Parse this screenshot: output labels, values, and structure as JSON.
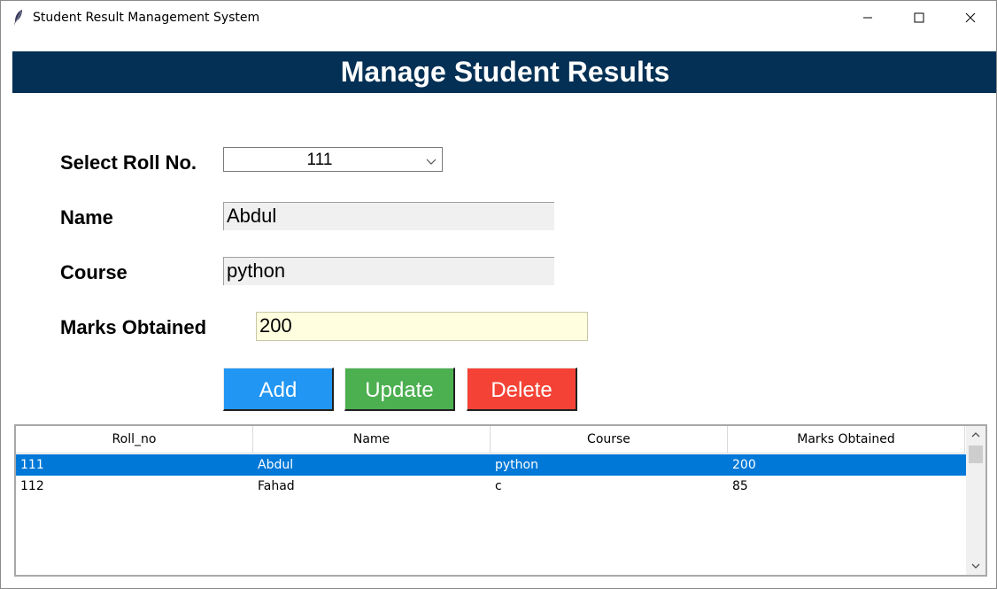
{
  "window": {
    "title": "Student Result Management System"
  },
  "banner": {
    "title": "Manage Student Results"
  },
  "form": {
    "roll_label": "Select Roll No.",
    "roll_value": "111",
    "name_label": "Name",
    "name_value": "Abdul",
    "course_label": "Course",
    "course_value": "python",
    "marks_label": "Marks Obtained",
    "marks_value": "200"
  },
  "buttons": {
    "add": "Add",
    "update": "Update",
    "delete": "Delete"
  },
  "colors": {
    "banner": "#033054",
    "add": "#2196f3",
    "update": "#4caf50",
    "delete": "#f44336",
    "selection": "#0078d7"
  },
  "table": {
    "columns": [
      "Roll_no",
      "Name",
      "Course",
      "Marks Obtained"
    ],
    "rows": [
      {
        "roll": "111",
        "name": "Abdul",
        "course": "python",
        "marks": "200"
      },
      {
        "roll": "112",
        "name": "Fahad",
        "course": "c",
        "marks": "85"
      }
    ]
  }
}
